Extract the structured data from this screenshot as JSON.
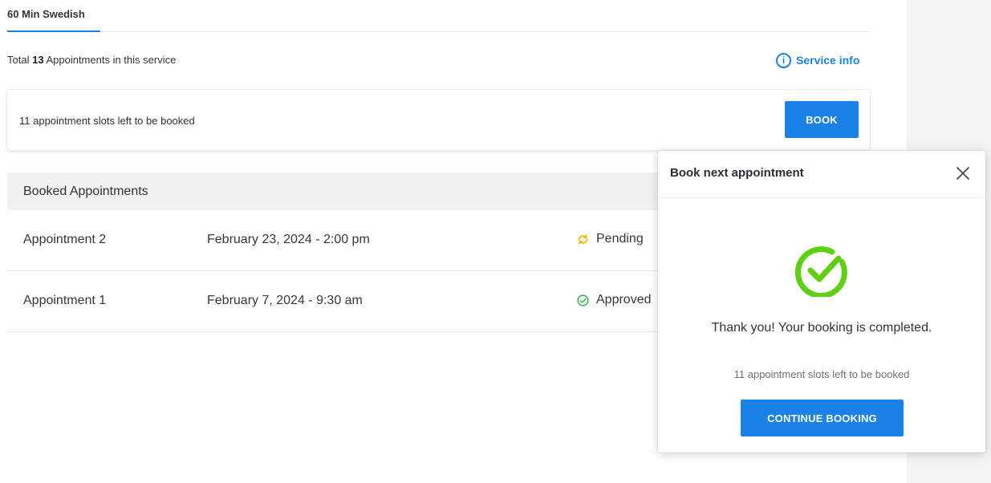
{
  "service": {
    "tab_label": "60 Min Swedish",
    "summary_prefix": "Total",
    "summary_count": "13",
    "summary_suffix": "Appointments in this service",
    "info_label": "Service info"
  },
  "slots_card": {
    "text": "11 appointment slots left to be booked",
    "book_label": "BOOK"
  },
  "booked": {
    "header": "Booked Appointments",
    "rows": [
      {
        "name": "Appointment 2",
        "date": "February 23, 2024 - 2:00 pm",
        "status": "Pending",
        "status_icon": "sync-icon",
        "status_color": "#f2b705"
      },
      {
        "name": "Appointment 1",
        "date": "February 7, 2024 - 9:30 am",
        "status": "Approved",
        "status_icon": "check-circle-icon",
        "status_color": "#2fb344"
      }
    ]
  },
  "popup": {
    "title": "Book next appointment",
    "message": "Thank you! Your booking is completed.",
    "slots": "11 appointment slots left to be booked",
    "continue_label": "CONTINUE BOOKING",
    "success_icon": "check-circle-icon",
    "success_color": "#5fcf12"
  },
  "colors": {
    "accent": "#1b82e5"
  }
}
